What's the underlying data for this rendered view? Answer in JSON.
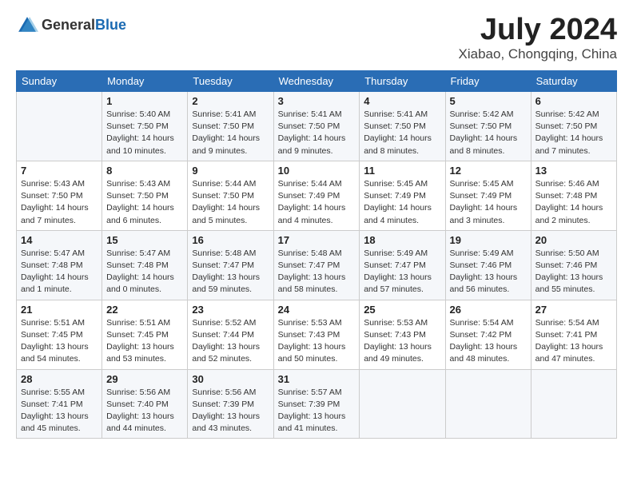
{
  "header": {
    "logo_general": "General",
    "logo_blue": "Blue",
    "month": "July 2024",
    "location": "Xiabao, Chongqing, China"
  },
  "days_of_week": [
    "Sunday",
    "Monday",
    "Tuesday",
    "Wednesday",
    "Thursday",
    "Friday",
    "Saturday"
  ],
  "weeks": [
    [
      {
        "day": "",
        "info": ""
      },
      {
        "day": "1",
        "info": "Sunrise: 5:40 AM\nSunset: 7:50 PM\nDaylight: 14 hours\nand 10 minutes."
      },
      {
        "day": "2",
        "info": "Sunrise: 5:41 AM\nSunset: 7:50 PM\nDaylight: 14 hours\nand 9 minutes."
      },
      {
        "day": "3",
        "info": "Sunrise: 5:41 AM\nSunset: 7:50 PM\nDaylight: 14 hours\nand 9 minutes."
      },
      {
        "day": "4",
        "info": "Sunrise: 5:41 AM\nSunset: 7:50 PM\nDaylight: 14 hours\nand 8 minutes."
      },
      {
        "day": "5",
        "info": "Sunrise: 5:42 AM\nSunset: 7:50 PM\nDaylight: 14 hours\nand 8 minutes."
      },
      {
        "day": "6",
        "info": "Sunrise: 5:42 AM\nSunset: 7:50 PM\nDaylight: 14 hours\nand 7 minutes."
      }
    ],
    [
      {
        "day": "7",
        "info": "Sunrise: 5:43 AM\nSunset: 7:50 PM\nDaylight: 14 hours\nand 7 minutes."
      },
      {
        "day": "8",
        "info": "Sunrise: 5:43 AM\nSunset: 7:50 PM\nDaylight: 14 hours\nand 6 minutes."
      },
      {
        "day": "9",
        "info": "Sunrise: 5:44 AM\nSunset: 7:50 PM\nDaylight: 14 hours\nand 5 minutes."
      },
      {
        "day": "10",
        "info": "Sunrise: 5:44 AM\nSunset: 7:49 PM\nDaylight: 14 hours\nand 4 minutes."
      },
      {
        "day": "11",
        "info": "Sunrise: 5:45 AM\nSunset: 7:49 PM\nDaylight: 14 hours\nand 4 minutes."
      },
      {
        "day": "12",
        "info": "Sunrise: 5:45 AM\nSunset: 7:49 PM\nDaylight: 14 hours\nand 3 minutes."
      },
      {
        "day": "13",
        "info": "Sunrise: 5:46 AM\nSunset: 7:48 PM\nDaylight: 14 hours\nand 2 minutes."
      }
    ],
    [
      {
        "day": "14",
        "info": "Sunrise: 5:47 AM\nSunset: 7:48 PM\nDaylight: 14 hours\nand 1 minute."
      },
      {
        "day": "15",
        "info": "Sunrise: 5:47 AM\nSunset: 7:48 PM\nDaylight: 14 hours\nand 0 minutes."
      },
      {
        "day": "16",
        "info": "Sunrise: 5:48 AM\nSunset: 7:47 PM\nDaylight: 13 hours\nand 59 minutes."
      },
      {
        "day": "17",
        "info": "Sunrise: 5:48 AM\nSunset: 7:47 PM\nDaylight: 13 hours\nand 58 minutes."
      },
      {
        "day": "18",
        "info": "Sunrise: 5:49 AM\nSunset: 7:47 PM\nDaylight: 13 hours\nand 57 minutes."
      },
      {
        "day": "19",
        "info": "Sunrise: 5:49 AM\nSunset: 7:46 PM\nDaylight: 13 hours\nand 56 minutes."
      },
      {
        "day": "20",
        "info": "Sunrise: 5:50 AM\nSunset: 7:46 PM\nDaylight: 13 hours\nand 55 minutes."
      }
    ],
    [
      {
        "day": "21",
        "info": "Sunrise: 5:51 AM\nSunset: 7:45 PM\nDaylight: 13 hours\nand 54 minutes."
      },
      {
        "day": "22",
        "info": "Sunrise: 5:51 AM\nSunset: 7:45 PM\nDaylight: 13 hours\nand 53 minutes."
      },
      {
        "day": "23",
        "info": "Sunrise: 5:52 AM\nSunset: 7:44 PM\nDaylight: 13 hours\nand 52 minutes."
      },
      {
        "day": "24",
        "info": "Sunrise: 5:53 AM\nSunset: 7:43 PM\nDaylight: 13 hours\nand 50 minutes."
      },
      {
        "day": "25",
        "info": "Sunrise: 5:53 AM\nSunset: 7:43 PM\nDaylight: 13 hours\nand 49 minutes."
      },
      {
        "day": "26",
        "info": "Sunrise: 5:54 AM\nSunset: 7:42 PM\nDaylight: 13 hours\nand 48 minutes."
      },
      {
        "day": "27",
        "info": "Sunrise: 5:54 AM\nSunset: 7:41 PM\nDaylight: 13 hours\nand 47 minutes."
      }
    ],
    [
      {
        "day": "28",
        "info": "Sunrise: 5:55 AM\nSunset: 7:41 PM\nDaylight: 13 hours\nand 45 minutes."
      },
      {
        "day": "29",
        "info": "Sunrise: 5:56 AM\nSunset: 7:40 PM\nDaylight: 13 hours\nand 44 minutes."
      },
      {
        "day": "30",
        "info": "Sunrise: 5:56 AM\nSunset: 7:39 PM\nDaylight: 13 hours\nand 43 minutes."
      },
      {
        "day": "31",
        "info": "Sunrise: 5:57 AM\nSunset: 7:39 PM\nDaylight: 13 hours\nand 41 minutes."
      },
      {
        "day": "",
        "info": ""
      },
      {
        "day": "",
        "info": ""
      },
      {
        "day": "",
        "info": ""
      }
    ]
  ]
}
